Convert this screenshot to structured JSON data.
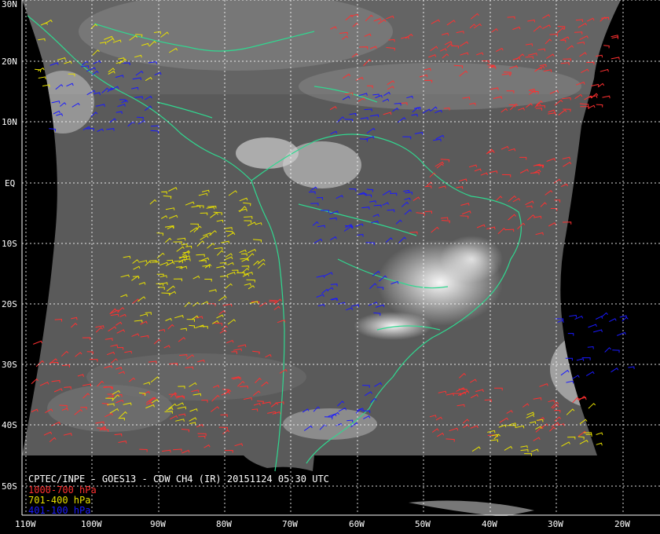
{
  "map": {
    "title": "CPTEC/INPE - GOES13 - CDW CH4 (IR) 20151124 05:30 UTC",
    "projection_extent": {
      "lon_min": -110,
      "lon_max": -16,
      "lat_min": -55,
      "lat_max": 30
    },
    "latitude_labels": [
      {
        "value": 30,
        "label": "30N"
      },
      {
        "value": 20,
        "label": "20N"
      },
      {
        "value": 10,
        "label": "10N"
      },
      {
        "value": 0,
        "label": "EQ"
      },
      {
        "value": -10,
        "label": "10S"
      },
      {
        "value": -20,
        "label": "20S"
      },
      {
        "value": -30,
        "label": "30S"
      },
      {
        "value": -40,
        "label": "40S"
      },
      {
        "value": -50,
        "label": "50S"
      }
    ],
    "longitude_labels": [
      {
        "value": -110,
        "label": "110W"
      },
      {
        "value": -100,
        "label": "100W"
      },
      {
        "value": -90,
        "label": "90W"
      },
      {
        "value": -80,
        "label": "80W"
      },
      {
        "value": -70,
        "label": "70W"
      },
      {
        "value": -60,
        "label": "60W"
      },
      {
        "value": -50,
        "label": "50W"
      },
      {
        "value": -40,
        "label": "40W"
      },
      {
        "value": -30,
        "label": "30W"
      },
      {
        "value": -20,
        "label": "20W"
      }
    ],
    "legend": [
      {
        "label": "1000-700 hPa",
        "color": "#ff3030"
      },
      {
        "label": "701-400 hPa",
        "color": "#e8e000"
      },
      {
        "label": "401-100 hPa",
        "color": "#1a1aff"
      }
    ],
    "colors": {
      "background": "#000000",
      "cloud_field": "#5a5a5a",
      "coastline": "#30d890",
      "grid": "#ffffff"
    }
  }
}
